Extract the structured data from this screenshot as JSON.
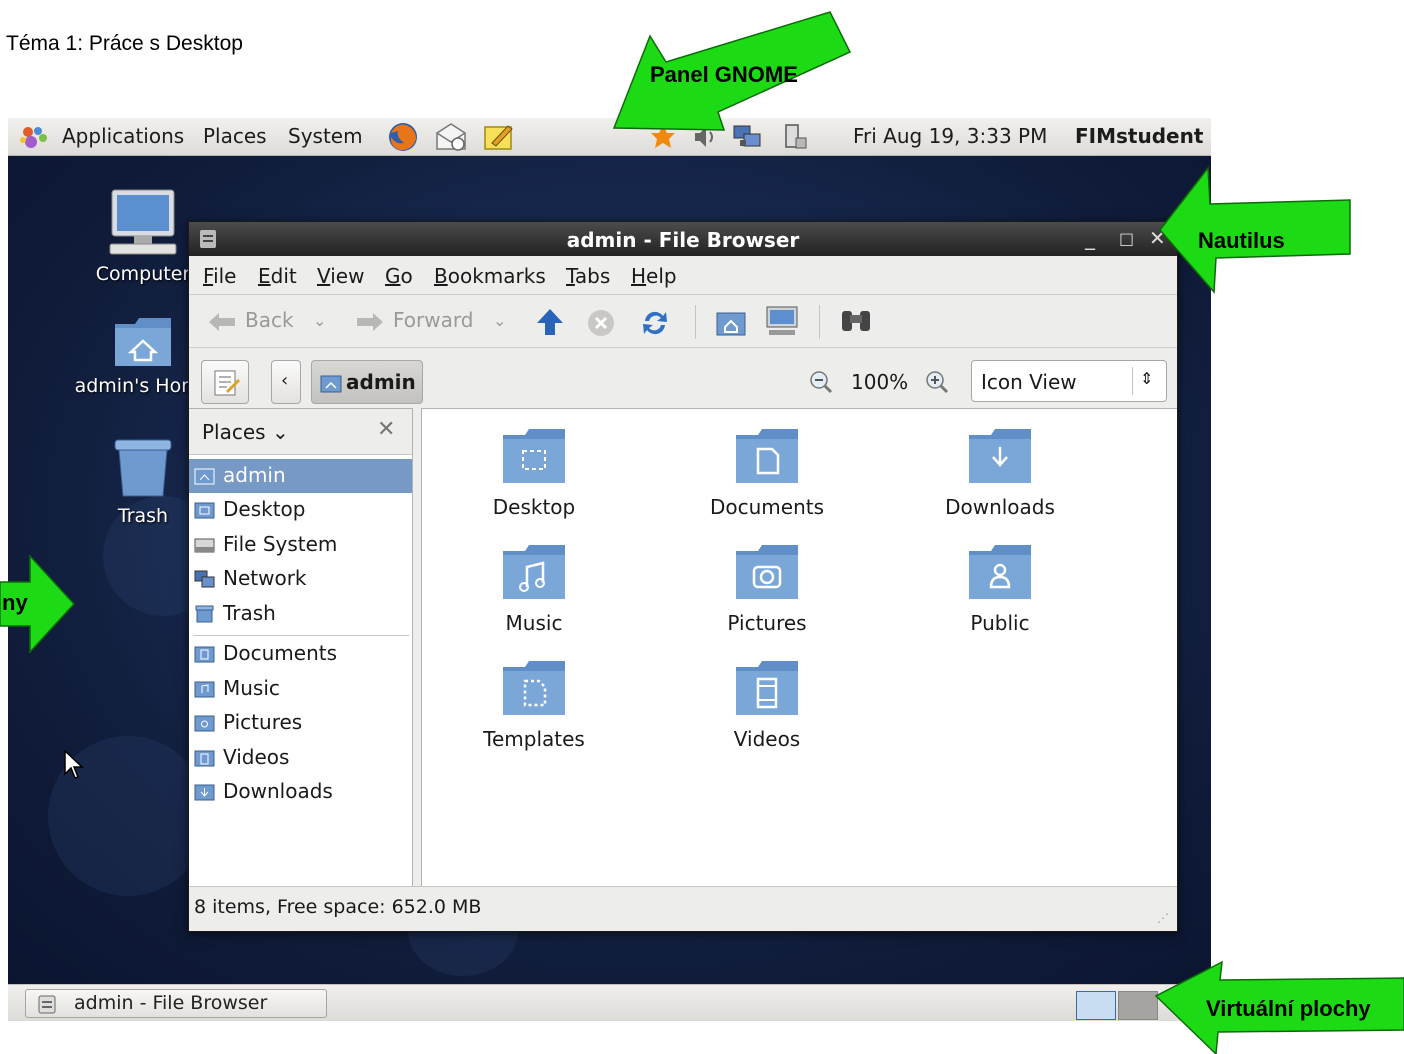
{
  "document": {
    "heading": "Téma 1: Práce s Desktop"
  },
  "annotations": {
    "panel": "Panel GNOME",
    "nautilus": "Nautilus",
    "desktop_partial": "ny",
    "workspaces": "Virtuální plochy",
    "arrow_color": "#1cdb14"
  },
  "top_panel": {
    "menus": [
      "Applications",
      "Places",
      "System"
    ],
    "launchers": [
      "firefox-icon",
      "mail-icon",
      "notes-icon"
    ],
    "tray": [
      "update-icon",
      "volume-icon",
      "network-icon",
      "power-icon"
    ],
    "clock": "Fri Aug 19,  3:33 PM",
    "user": "FIMstudent"
  },
  "desktop_icons": [
    {
      "label": "Computer",
      "icon": "computer-icon"
    },
    {
      "label": "admin's Home",
      "icon": "home-folder-icon"
    },
    {
      "label": "Trash",
      "icon": "trash-icon"
    }
  ],
  "window": {
    "title": "admin - File Browser",
    "menus": [
      {
        "ul": "F",
        "rest": "ile"
      },
      {
        "ul": "E",
        "rest": "dit"
      },
      {
        "ul": "V",
        "rest": "iew"
      },
      {
        "ul": "G",
        "rest": "o"
      },
      {
        "ul": "B",
        "rest": "ookmarks"
      },
      {
        "ul": "T",
        "rest": "abs"
      },
      {
        "ul": "H",
        "rest": "elp"
      }
    ],
    "toolbar": {
      "back": "Back",
      "forward": "Forward"
    },
    "location": {
      "current": "admin",
      "zoom": "100%",
      "view_mode": "Icon View"
    },
    "sidebar": {
      "header": "Places",
      "items": [
        "admin",
        "Desktop",
        "File System",
        "Network",
        "Trash"
      ],
      "bookmarks": [
        "Documents",
        "Music",
        "Pictures",
        "Videos",
        "Downloads"
      ],
      "selected": "admin"
    },
    "files": [
      "Desktop",
      "Documents",
      "Downloads",
      "Music",
      "Pictures",
      "Public",
      "Templates",
      "Videos"
    ],
    "status": "8 items, Free space: 652.0 MB"
  },
  "bottom_panel": {
    "task": "admin - File Browser",
    "workspaces": 2,
    "active_workspace": 1
  }
}
